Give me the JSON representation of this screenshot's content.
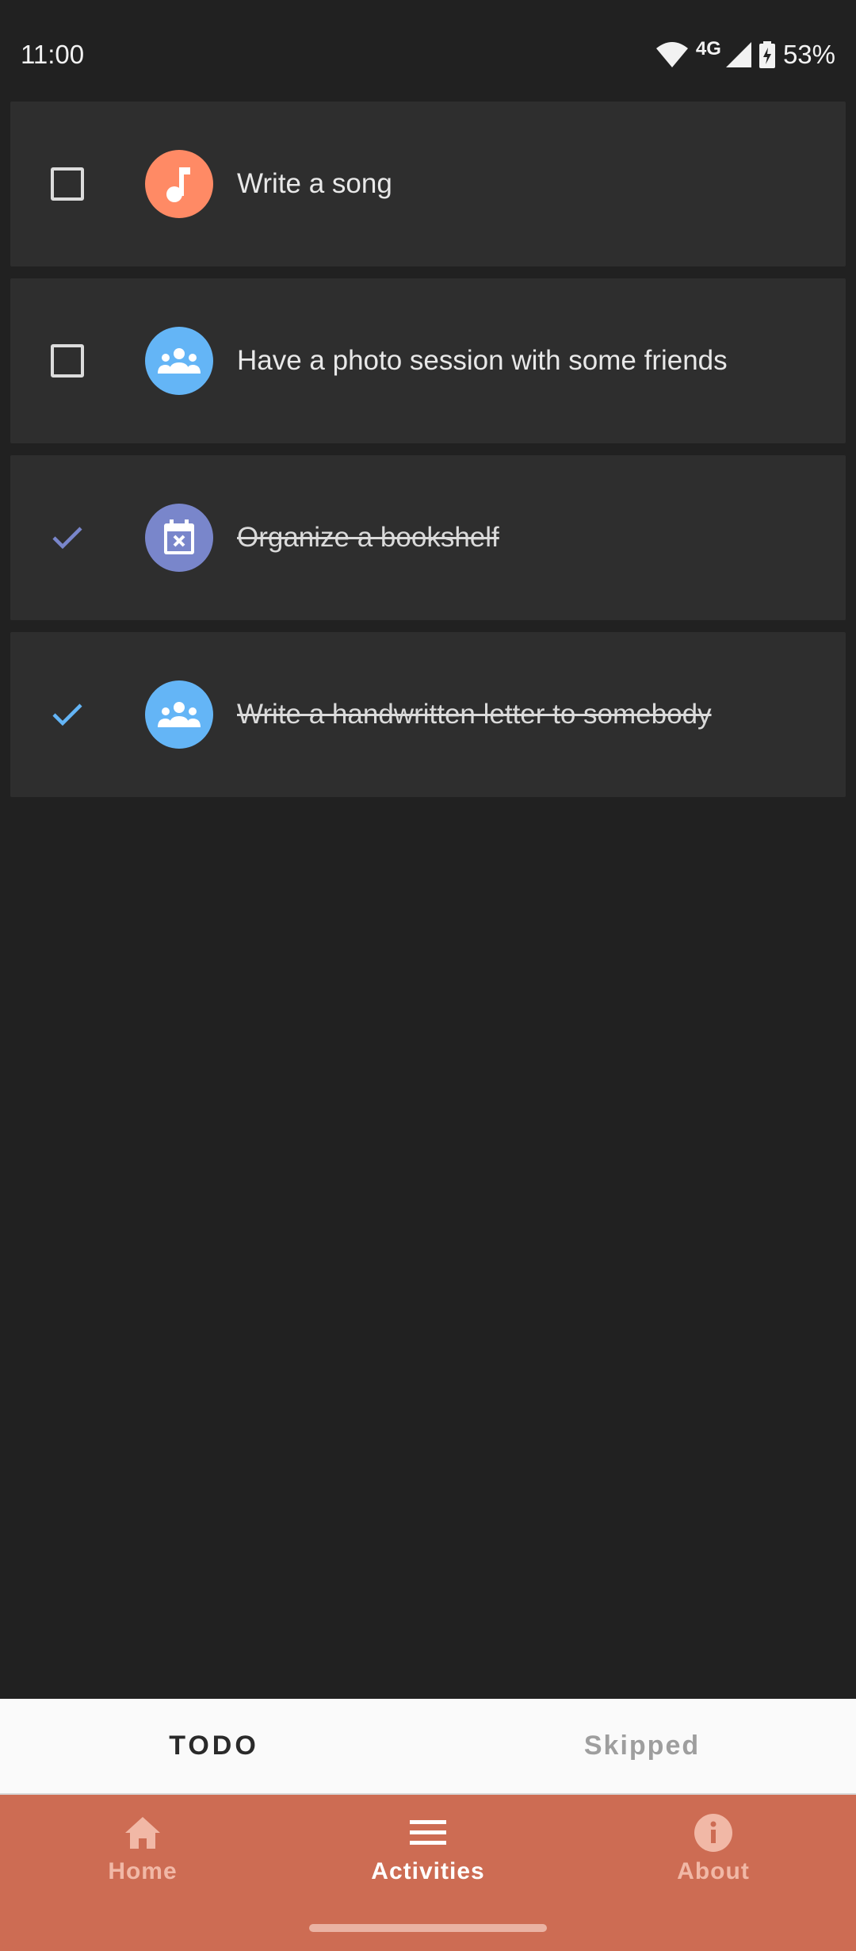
{
  "status_bar": {
    "time": "11:00",
    "network": "4G",
    "battery": "53%"
  },
  "activities": [
    {
      "label": "Write a song",
      "done": false,
      "icon": "music-note-icon",
      "icon_color": "#ff8a65"
    },
    {
      "label": "Have a photo session with some friends",
      "done": false,
      "icon": "group-icon",
      "icon_color": "#64b5f6"
    },
    {
      "label": "Organize a bookshelf",
      "done": true,
      "icon": "calendar-cancel-icon",
      "icon_color": "#7986cb"
    },
    {
      "label": "Write a handwritten letter to somebody",
      "done": true,
      "icon": "group-icon",
      "icon_color": "#64b5f6"
    }
  ],
  "tabs": {
    "todo": "TODO",
    "skipped": "Skipped"
  },
  "bottom_nav": {
    "home": "Home",
    "activities": "Activities",
    "about": "About"
  },
  "colors": {
    "background": "#212121",
    "card": "#2e2e2e",
    "nav_bar": "#cd6c53",
    "check_purple": "#7986cb",
    "check_blue": "#64b5f6"
  }
}
